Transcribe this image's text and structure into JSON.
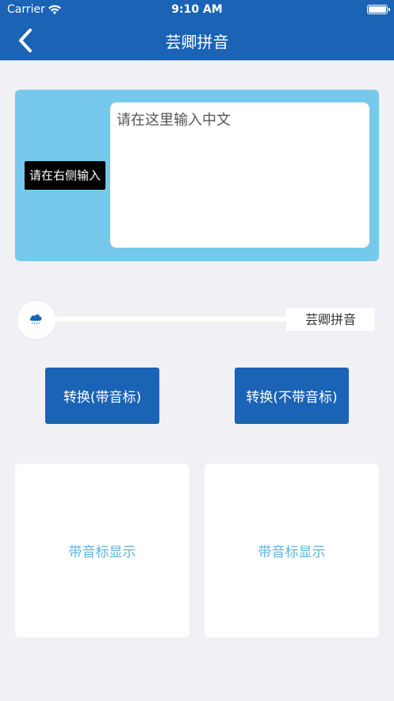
{
  "status_bar": {
    "carrier": "Carrier",
    "time": "9:10 AM",
    "icons": [
      "wifi-icon",
      "battery-icon"
    ]
  },
  "nav": {
    "title": "芸卿拼音",
    "back_icon": "chevron-left-icon",
    "background": "#1a63b5"
  },
  "input": {
    "label": "请在右侧输入",
    "placeholder": "请在这里输入中文",
    "value": "",
    "panel_color": "#77c9ec"
  },
  "slider": {
    "label": "芸卿拼音",
    "thumb_icon": "cloud-rain-icon",
    "value_fraction": 0
  },
  "buttons": {
    "with_tone": "转换(带音标)",
    "without_tone": "转换(不带音标)"
  },
  "results": {
    "left": "带音标显示",
    "right": "带音标显示",
    "text_color": "#5fb4e0"
  }
}
